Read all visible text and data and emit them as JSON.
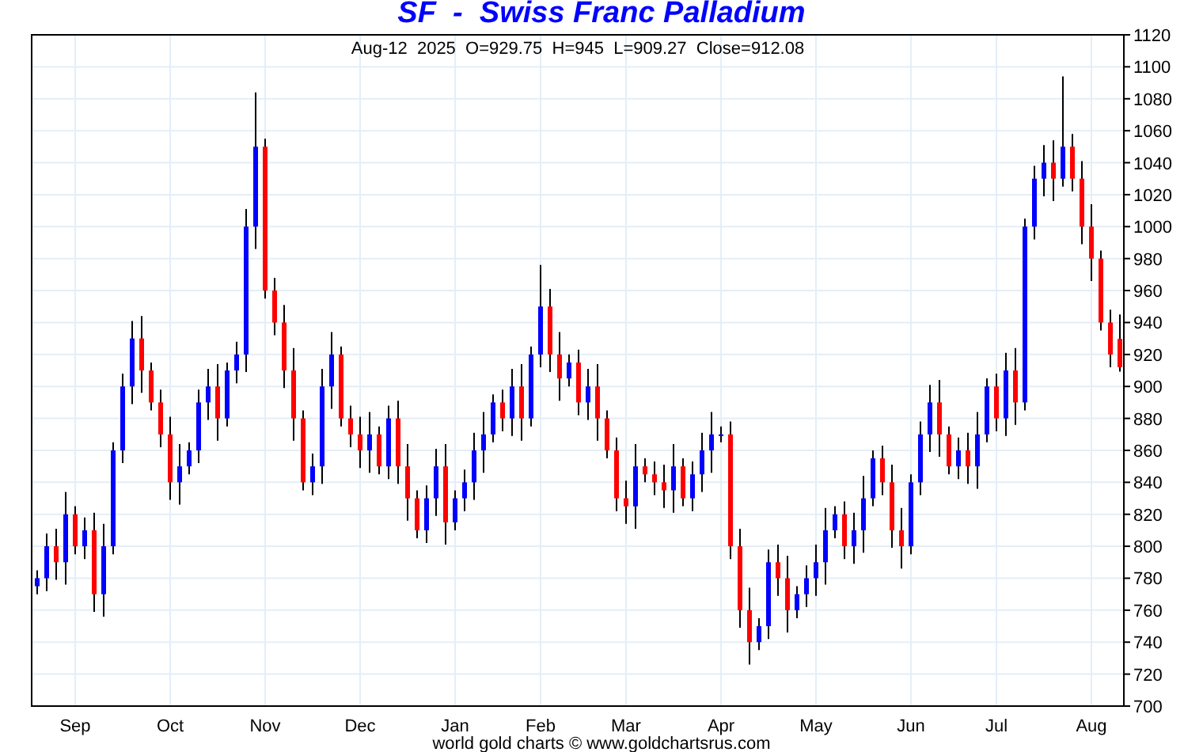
{
  "title": "SF  -  Swiss Franc Palladium",
  "chart_data": {
    "type": "candlestick",
    "grid": true,
    "ylim": [
      700,
      1120
    ],
    "yticks": [
      700,
      720,
      740,
      760,
      780,
      800,
      820,
      840,
      860,
      880,
      900,
      920,
      940,
      960,
      980,
      1000,
      1020,
      1040,
      1060,
      1080,
      1100,
      1120
    ],
    "categories": [
      null,
      null,
      null,
      null,
      "Sep",
      null,
      null,
      null,
      null,
      null,
      null,
      null,
      null,
      null,
      "Oct",
      null,
      null,
      null,
      null,
      null,
      null,
      null,
      null,
      null,
      "Nov",
      null,
      null,
      null,
      null,
      null,
      null,
      null,
      null,
      null,
      "Dec",
      null,
      null,
      null,
      null,
      null,
      null,
      null,
      null,
      null,
      "Jan",
      null,
      null,
      null,
      null,
      null,
      null,
      null,
      null,
      "Feb",
      null,
      null,
      null,
      null,
      null,
      null,
      null,
      null,
      "Mar",
      null,
      null,
      null,
      null,
      null,
      null,
      null,
      null,
      null,
      "Apr",
      null,
      null,
      null,
      null,
      null,
      null,
      null,
      null,
      null,
      "May",
      null,
      null,
      null,
      null,
      null,
      null,
      null,
      null,
      null,
      "Jun",
      null,
      null,
      null,
      null,
      null,
      null,
      null,
      null,
      "Jul",
      null,
      null,
      null,
      null,
      null,
      null,
      null,
      null,
      null,
      "Aug",
      null,
      null,
      null
    ],
    "annotations": [
      "Aug-12  2025  O=929.75  H=945  L=909.27  Close=912.08"
    ],
    "ohlc": [
      [
        775,
        785,
        770,
        780
      ],
      [
        780,
        808,
        772,
        800
      ],
      [
        800,
        811,
        779,
        790
      ],
      [
        790,
        834,
        776,
        820
      ],
      [
        820,
        825,
        795,
        800
      ],
      [
        800,
        818,
        792,
        810
      ],
      [
        810,
        821,
        759,
        770
      ],
      [
        770,
        814,
        756,
        800
      ],
      [
        800,
        865,
        795,
        860
      ],
      [
        860,
        908,
        852,
        900
      ],
      [
        900,
        941,
        889,
        930
      ],
      [
        930,
        944,
        896,
        910
      ],
      [
        910,
        915,
        885,
        890
      ],
      [
        890,
        898,
        862,
        870
      ],
      [
        870,
        881,
        829,
        840
      ],
      [
        840,
        864,
        826,
        850
      ],
      [
        850,
        865,
        845,
        860
      ],
      [
        860,
        898,
        852,
        890
      ],
      [
        890,
        911,
        879,
        900
      ],
      [
        900,
        914,
        866,
        880
      ],
      [
        880,
        915,
        875,
        910
      ],
      [
        910,
        928,
        902,
        920
      ],
      [
        920,
        1011,
        909,
        1000
      ],
      [
        1000,
        1084,
        986,
        1050
      ],
      [
        1050,
        1055,
        955,
        960
      ],
      [
        960,
        968,
        932,
        940
      ],
      [
        940,
        951,
        899,
        910
      ],
      [
        910,
        924,
        866,
        880
      ],
      [
        880,
        885,
        835,
        840
      ],
      [
        840,
        858,
        832,
        850
      ],
      [
        850,
        911,
        839,
        900
      ],
      [
        900,
        934,
        886,
        920
      ],
      [
        920,
        925,
        875,
        880
      ],
      [
        880,
        888,
        862,
        870
      ],
      [
        870,
        881,
        849,
        860
      ],
      [
        860,
        884,
        846,
        870
      ],
      [
        870,
        875,
        845,
        850
      ],
      [
        850,
        888,
        842,
        880
      ],
      [
        880,
        891,
        839,
        850
      ],
      [
        850,
        864,
        816,
        830
      ],
      [
        830,
        835,
        805,
        810
      ],
      [
        810,
        838,
        802,
        830
      ],
      [
        830,
        861,
        819,
        850
      ],
      [
        850,
        864,
        801,
        815
      ],
      [
        815,
        835,
        810,
        830
      ],
      [
        830,
        848,
        822,
        840
      ],
      [
        840,
        871,
        829,
        860
      ],
      [
        860,
        884,
        846,
        870
      ],
      [
        870,
        895,
        865,
        890
      ],
      [
        890,
        898,
        872,
        880
      ],
      [
        880,
        911,
        869,
        900
      ],
      [
        900,
        914,
        866,
        880
      ],
      [
        880,
        925,
        875,
        920
      ],
      [
        920,
        976,
        912,
        950
      ],
      [
        950,
        961,
        909,
        920
      ],
      [
        920,
        934,
        891,
        905
      ],
      [
        905,
        920,
        900,
        915
      ],
      [
        915,
        923,
        882,
        890
      ],
      [
        890,
        911,
        879,
        900
      ],
      [
        900,
        914,
        866,
        880
      ],
      [
        880,
        885,
        855,
        860
      ],
      [
        860,
        868,
        822,
        830
      ],
      [
        830,
        841,
        814,
        825
      ],
      [
        825,
        864,
        811,
        850
      ],
      [
        850,
        855,
        840,
        845
      ],
      [
        845,
        853,
        832,
        840
      ],
      [
        840,
        851,
        824,
        835
      ],
      [
        835,
        864,
        821,
        850
      ],
      [
        850,
        855,
        825,
        830
      ],
      [
        830,
        853,
        822,
        845
      ],
      [
        845,
        871,
        834,
        860
      ],
      [
        860,
        884,
        846,
        870
      ],
      [
        870,
        875,
        865,
        870
      ],
      [
        870,
        878,
        792,
        800
      ],
      [
        800,
        811,
        749,
        760
      ],
      [
        760,
        774,
        726,
        740
      ],
      [
        740,
        755,
        735,
        750
      ],
      [
        750,
        798,
        742,
        790
      ],
      [
        790,
        801,
        769,
        780
      ],
      [
        780,
        794,
        746,
        760
      ],
      [
        760,
        775,
        755,
        770
      ],
      [
        770,
        788,
        762,
        780
      ],
      [
        780,
        801,
        769,
        790
      ],
      [
        790,
        824,
        776,
        810
      ],
      [
        810,
        825,
        805,
        820
      ],
      [
        820,
        828,
        792,
        800
      ],
      [
        800,
        821,
        789,
        810
      ],
      [
        810,
        844,
        796,
        830
      ],
      [
        830,
        860,
        825,
        855
      ],
      [
        855,
        863,
        832,
        840
      ],
      [
        840,
        851,
        799,
        810
      ],
      [
        810,
        824,
        786,
        800
      ],
      [
        800,
        845,
        795,
        840
      ],
      [
        840,
        878,
        832,
        870
      ],
      [
        870,
        901,
        859,
        890
      ],
      [
        890,
        904,
        856,
        870
      ],
      [
        870,
        875,
        845,
        850
      ],
      [
        850,
        868,
        842,
        860
      ],
      [
        860,
        871,
        839,
        850
      ],
      [
        850,
        884,
        836,
        870
      ],
      [
        870,
        905,
        865,
        900
      ],
      [
        900,
        908,
        872,
        880
      ],
      [
        880,
        921,
        869,
        910
      ],
      [
        910,
        924,
        876,
        890
      ],
      [
        890,
        1005,
        885,
        1000
      ],
      [
        1000,
        1038,
        992,
        1030
      ],
      [
        1030,
        1051,
        1019,
        1040
      ],
      [
        1040,
        1054,
        1016,
        1030
      ],
      [
        1030,
        1094,
        1025,
        1050
      ],
      [
        1050,
        1058,
        1022,
        1030
      ],
      [
        1030,
        1041,
        989,
        1000
      ],
      [
        1000,
        1014,
        966,
        980
      ],
      [
        980,
        985,
        935,
        940
      ],
      [
        940,
        948,
        912,
        920
      ],
      [
        929.75,
        945,
        909.27,
        912.08
      ]
    ]
  },
  "footer": "world gold charts © www.goldchartsrus.com"
}
